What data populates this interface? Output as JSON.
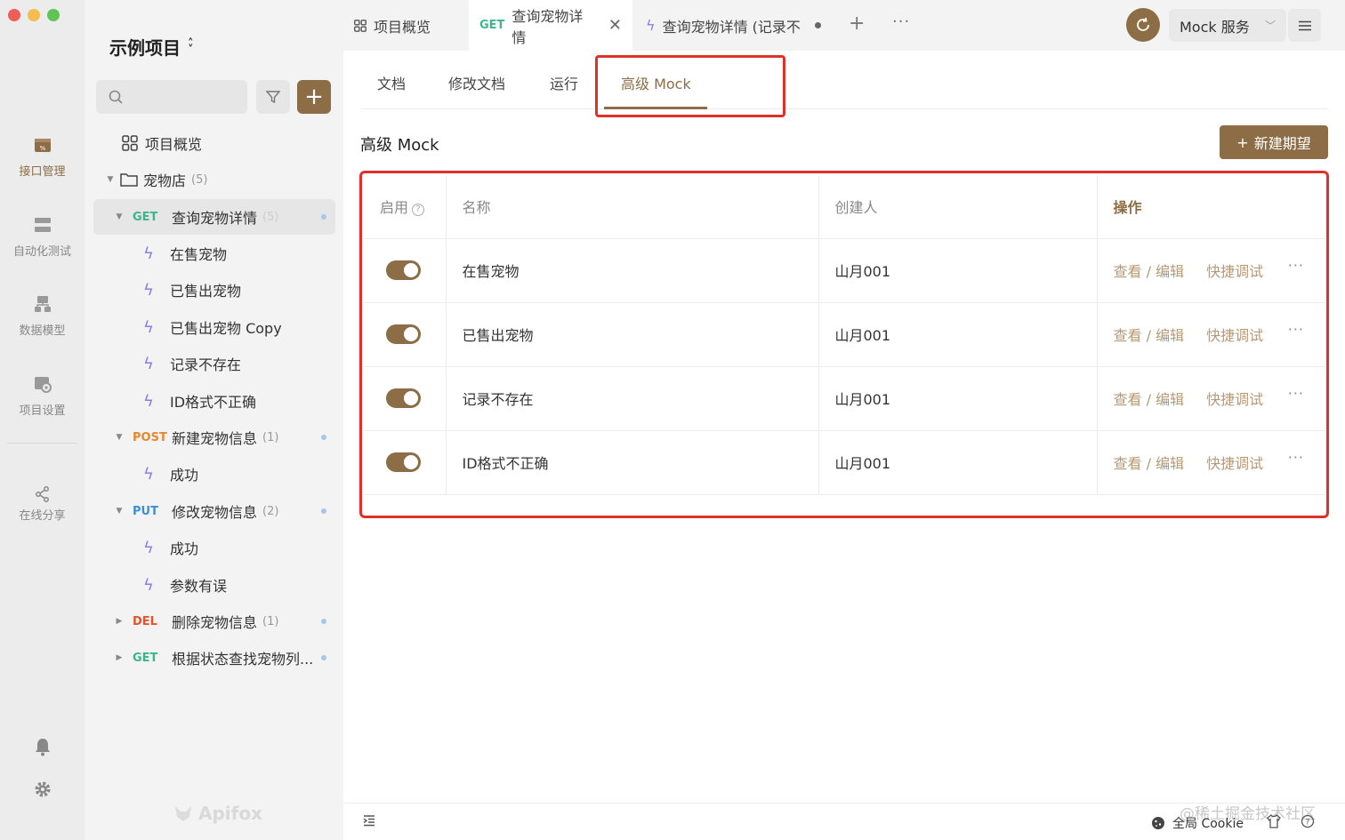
{
  "rail": {
    "items": [
      {
        "label": "接口管理",
        "icon": "api-management-icon",
        "active": true
      },
      {
        "label": "自动化测试",
        "icon": "automation-test-icon",
        "active": false
      },
      {
        "label": "数据模型",
        "icon": "data-model-icon",
        "active": false
      },
      {
        "label": "项目设置",
        "icon": "project-settings-icon",
        "active": false
      },
      {
        "label": "在线分享",
        "icon": "share-icon",
        "active": false
      }
    ]
  },
  "sidebar": {
    "project_title": "示例项目",
    "tree": {
      "overview": "项目概览",
      "folder": {
        "label": "宠物店",
        "count": "(5)"
      },
      "get_pet": {
        "method": "GET",
        "label": "查询宠物详情",
        "count": "(5)"
      },
      "get_pet_cases": [
        "在售宠物",
        "已售出宠物",
        "已售出宠物 Copy",
        "记录不存在",
        "ID格式不正确"
      ],
      "post_pet": {
        "method": "POST",
        "label": "新建宠物信息",
        "count": "(1)"
      },
      "post_pet_cases": [
        "成功"
      ],
      "put_pet": {
        "method": "PUT",
        "label": "修改宠物信息",
        "count": "(2)"
      },
      "put_pet_cases": [
        "成功",
        "参数有误"
      ],
      "del_pet": {
        "method": "DEL",
        "label": "删除宠物信息",
        "count": "(1)"
      },
      "get_by_status": {
        "method": "GET",
        "label": "根据状态查找宠物列..."
      }
    },
    "brand": "Apifox"
  },
  "topbar": {
    "tabs": [
      {
        "label": "项目概览"
      },
      {
        "method": "GET",
        "label": "查询宠物详情"
      },
      {
        "label": "查询宠物详情 (记录不"
      }
    ],
    "env": "Mock 服务"
  },
  "content": {
    "subtabs": [
      "文档",
      "修改文档",
      "运行",
      "高级 Mock"
    ],
    "section_title": "高级 Mock",
    "new_button": "新建期望",
    "table": {
      "headers": {
        "enabled": "启用",
        "name": "名称",
        "creator": "创建人",
        "ops": "操作"
      },
      "rows": [
        {
          "name": "在售宠物",
          "creator": "山月001",
          "enabled": true
        },
        {
          "name": "已售出宠物",
          "creator": "山月001",
          "enabled": true
        },
        {
          "name": "记录不存在",
          "creator": "山月001",
          "enabled": true
        },
        {
          "name": "ID格式不正确",
          "creator": "山月001",
          "enabled": true
        }
      ],
      "op_view_edit": "查看 / 编辑",
      "op_quick_debug": "快捷调试"
    }
  },
  "footer": {
    "cookie": "全局 Cookie",
    "watermark": "@稀土掘金技术社区"
  },
  "colors": {
    "accent": "#8c6d46",
    "highlight": "#e0302a",
    "get": "#3eb58c",
    "post": "#e7872e",
    "put": "#3b8fd9",
    "del": "#e2542d"
  }
}
